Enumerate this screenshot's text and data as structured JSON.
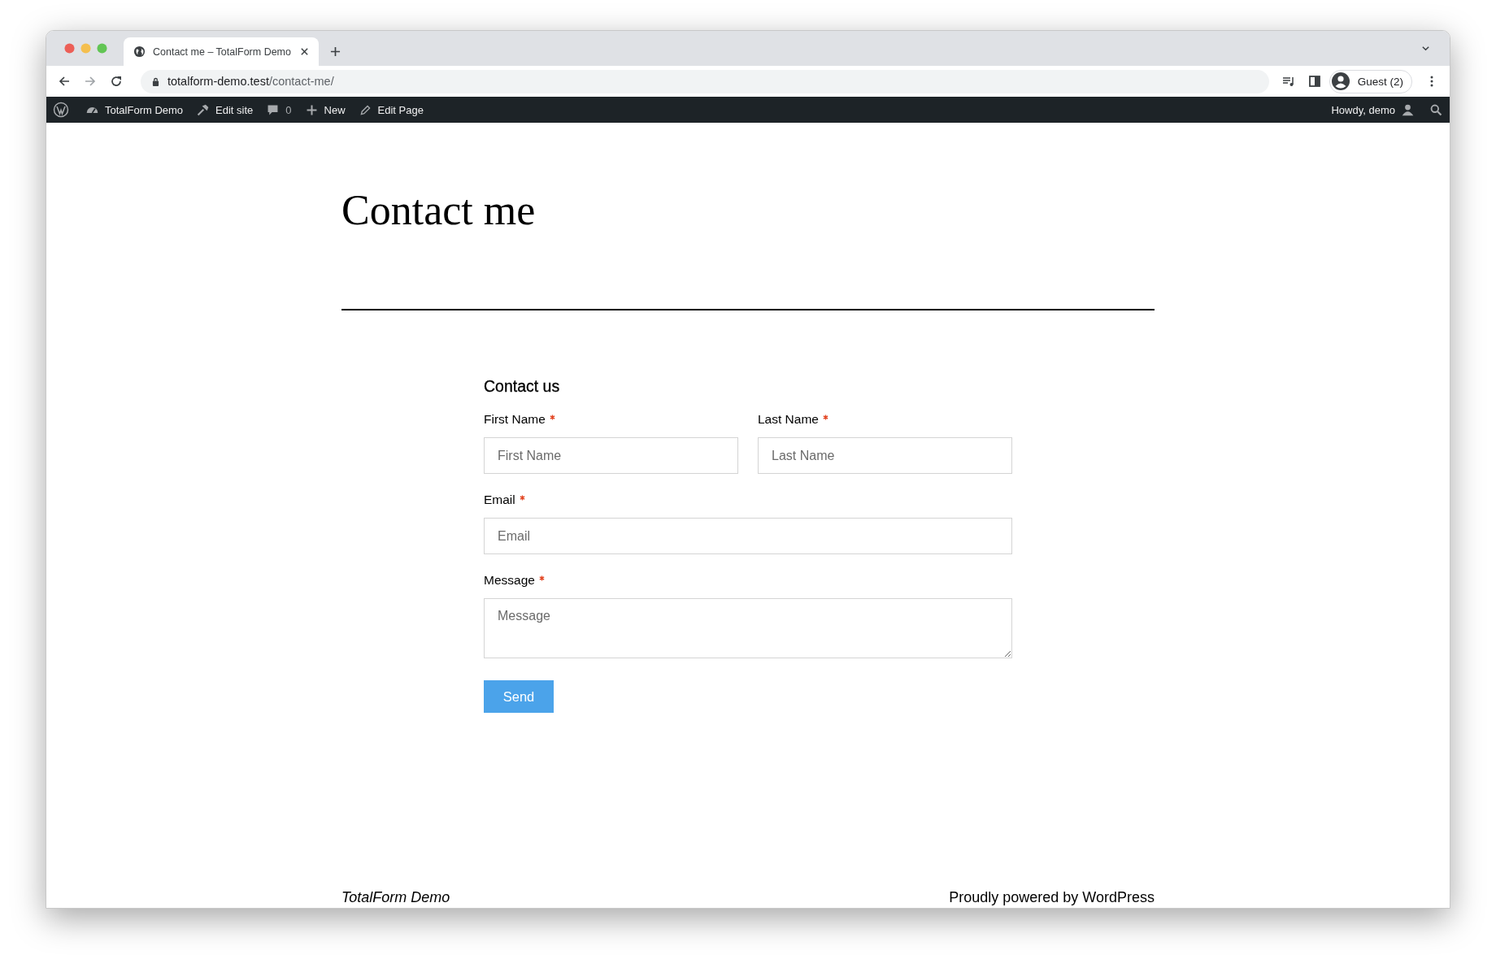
{
  "browser": {
    "tab": {
      "title": "Contact me – TotalForm Demo"
    },
    "url": {
      "host": "totalform-demo.test",
      "path": "/contact-me/"
    },
    "profile": "Guest (2)"
  },
  "admin_bar": {
    "items": [
      {
        "label": "TotalForm Demo"
      },
      {
        "label": "Edit site"
      },
      {
        "label": "0"
      },
      {
        "label": "New"
      },
      {
        "label": "Edit Page"
      }
    ],
    "greeting": "Howdy, demo"
  },
  "page": {
    "title": "Contact me"
  },
  "form": {
    "title": "Contact us",
    "rows": [
      [
        {
          "label": "First Name",
          "required": true,
          "placeholder": "First Name",
          "kind": "text"
        },
        {
          "label": "Last Name",
          "required": true,
          "placeholder": "Last Name",
          "kind": "text"
        }
      ],
      [
        {
          "label": "Email",
          "required": true,
          "placeholder": "Email",
          "kind": "text"
        }
      ],
      [
        {
          "label": "Message",
          "required": true,
          "placeholder": "Message",
          "kind": "textarea"
        }
      ]
    ],
    "submit": "Send"
  },
  "footer": {
    "site": "TotalForm Demo",
    "credit": "Proudly powered by WordPress"
  }
}
